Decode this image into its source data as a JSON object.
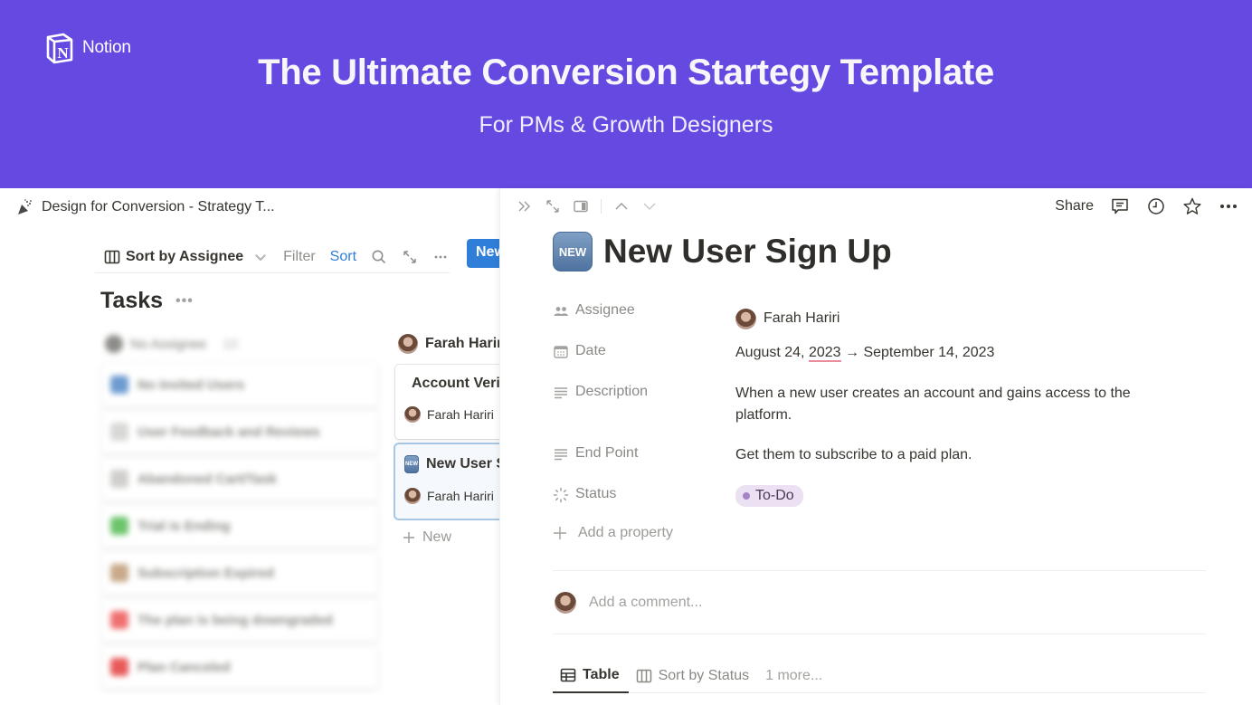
{
  "banner": {
    "brand_name": "Notion",
    "title": "The Ultimate Conversion Startegy Template",
    "subtitle": "For PMs & Growth Designers",
    "background": "#6549e1"
  },
  "page": {
    "breadcrumb_title": "Design for Conversion - Strategy T..."
  },
  "toolbar": {
    "view_label": "Sort by Assignee",
    "filter_label": "Filter",
    "sort_label": "Sort",
    "new_label": "New",
    "accent": "#2f7ed8"
  },
  "board": {
    "title": "Tasks",
    "columns": [
      {
        "name": "No Assignee",
        "count": "10",
        "blurred": true,
        "cards": [
          {
            "title": "No Invited Users",
            "icon_color": "#6d9bd1"
          },
          {
            "title": "User Feedback and Reviews",
            "icon_color": "#d8d8d6"
          },
          {
            "title": "Abandoned Cart/Task",
            "icon_color": "#d0cfcc"
          },
          {
            "title": "Trial is Ending",
            "icon_color": "#6cc46c"
          },
          {
            "title": "Subscription Expired",
            "icon_color": "#c9a98a"
          },
          {
            "title": "The plan is being downgraded",
            "icon_color": "#f07070"
          },
          {
            "title": "Plan Canceled",
            "icon_color": "#e85a5a"
          }
        ]
      },
      {
        "name": "Farah Hariri",
        "cards": [
          {
            "title": "Account Verification",
            "assignee": "Farah Hariri",
            "icon": "envelope-icon"
          },
          {
            "title": "New User Sign Up",
            "assignee": "Farah Hariri",
            "icon": "new-button-icon",
            "selected": true
          }
        ],
        "add_label": "New"
      }
    ]
  },
  "peek": {
    "topbar": {
      "share_label": "Share"
    },
    "title": "New User Sign Up",
    "emoji_text": "NEW",
    "properties": [
      {
        "label": "Assignee",
        "value": "Farah Hariri"
      },
      {
        "label": "Date",
        "value_start": "August 24, ",
        "value_year": "2023",
        "value_end": " → September 14, 2023"
      },
      {
        "label": "Description",
        "value": "When a new user creates an account and gains access to the platform."
      },
      {
        "label": "End Point",
        "value": "Get them to subscribe to a paid plan."
      },
      {
        "label": "Status",
        "value": "To-Do",
        "status_color": "#ebe1f3"
      }
    ],
    "add_property_label": "Add a property",
    "comment_placeholder": "Add a comment...",
    "tabs": [
      {
        "label": "Table",
        "active": true
      },
      {
        "label": "Sort by Status",
        "active": false
      }
    ],
    "tabs_more": "1 more..."
  }
}
